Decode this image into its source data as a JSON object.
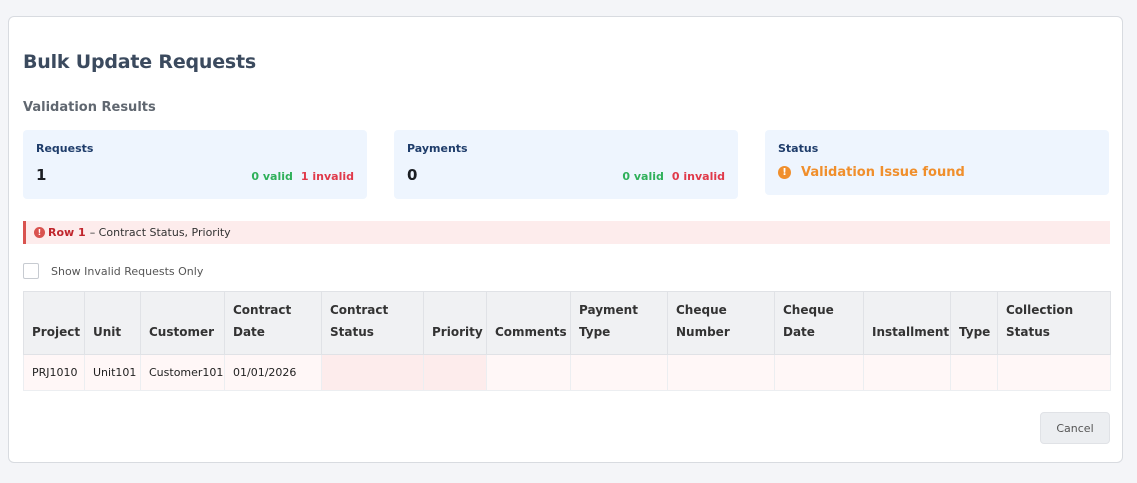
{
  "dialog": {
    "title": "Bulk Update Requests",
    "subtitle": "Validation Results"
  },
  "cards": {
    "requests": {
      "label": "Requests",
      "value": "1",
      "valid": "0 valid",
      "invalid": "1 invalid"
    },
    "payments": {
      "label": "Payments",
      "value": "0",
      "valid": "0 valid",
      "invalid": "0 invalid"
    },
    "status": {
      "label": "Status",
      "icon": "!",
      "text": "Validation Issue found"
    }
  },
  "error": {
    "icon": "!",
    "row": "Row 1",
    "message": "– Contract Status, Priority"
  },
  "filter": {
    "checkbox_label": "Show Invalid Requests Only"
  },
  "table": {
    "headers": [
      "Project",
      "Unit",
      "Customer",
      "Contract Date",
      "Contract Status",
      "Priority",
      "Comments",
      "Payment Type",
      "Cheque Number",
      "Cheque Date",
      "Installment",
      "Type",
      "Collection Status"
    ],
    "rows": [
      [
        "PRJ1010",
        "Unit101",
        "Customer101",
        "01/01/2026",
        "",
        "",
        "",
        "",
        "",
        "",
        "",
        "",
        ""
      ]
    ]
  },
  "footer": {
    "cancel_label": "Cancel"
  },
  "colors": {
    "valid": "#2fb05a",
    "invalid": "#e0394a",
    "warning": "#f08f2c",
    "card_bg": "#eef5fe",
    "error_bg": "#fdecec"
  }
}
